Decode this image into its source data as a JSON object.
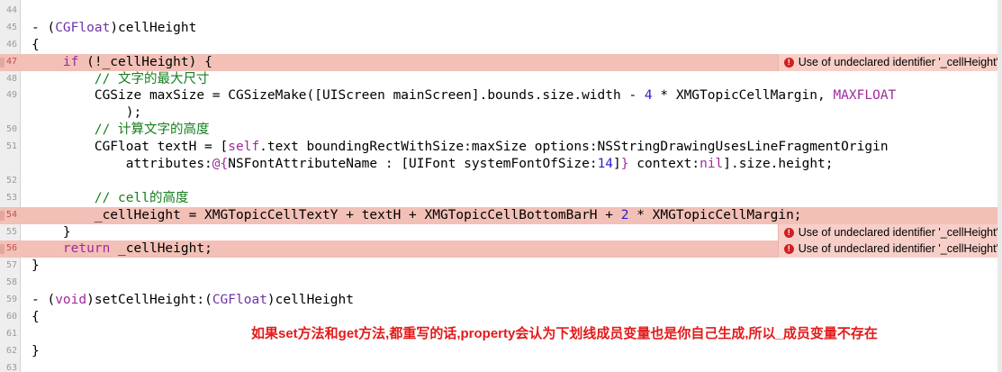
{
  "editor": {
    "lines": [
      {
        "num": "44",
        "tokens": [
          {
            "t": "",
            "c": ""
          }
        ]
      },
      {
        "num": "45",
        "tokens": [
          {
            "t": "- (",
            "c": ""
          },
          {
            "t": "CGFloat",
            "c": "ty"
          },
          {
            "t": ")cellHeight",
            "c": ""
          }
        ]
      },
      {
        "num": "46",
        "tokens": [
          {
            "t": "{",
            "c": ""
          }
        ]
      },
      {
        "num": "47",
        "error": true,
        "badge": "Use of undeclared identifier '_cellHeight'",
        "tokens": [
          {
            "t": "    ",
            "c": ""
          },
          {
            "t": "if",
            "c": "kw"
          },
          {
            "t": " (!_cellHeight) {",
            "c": ""
          }
        ]
      },
      {
        "num": "48",
        "tokens": [
          {
            "t": "        // 文字的最大尺寸",
            "c": "cm"
          }
        ]
      },
      {
        "num": "49",
        "tokens": [
          {
            "t": "        CGSize maxSize = CGSizeMake([UIScreen mainScreen].bounds.size.width - ",
            "c": ""
          },
          {
            "t": "4",
            "c": "num"
          },
          {
            "t": " * XMGTopicCellMargin, ",
            "c": ""
          },
          {
            "t": "MAXFLOAT",
            "c": "kw"
          }
        ]
      },
      {
        "num": "",
        "tokens": [
          {
            "t": "            );",
            "c": ""
          }
        ]
      },
      {
        "num": "50",
        "tokens": [
          {
            "t": "        // 计算文字的高度",
            "c": "cm"
          }
        ]
      },
      {
        "num": "51",
        "tokens": [
          {
            "t": "        CGFloat textH = [",
            "c": ""
          },
          {
            "t": "self",
            "c": "kw"
          },
          {
            "t": ".text boundingRectWithSize:maxSize options:NSStringDrawingUsesLineFragmentOrigin",
            "c": ""
          }
        ]
      },
      {
        "num": "",
        "tokens": [
          {
            "t": "            attributes:",
            "c": ""
          },
          {
            "t": "@{",
            "c": "kw"
          },
          {
            "t": "NSFontAttributeName : [UIFont systemFontOfSize:",
            "c": ""
          },
          {
            "t": "14",
            "c": "num"
          },
          {
            "t": "]",
            "c": ""
          },
          {
            "t": "}",
            "c": "kw"
          },
          {
            "t": " context:",
            "c": ""
          },
          {
            "t": "nil",
            "c": "kw"
          },
          {
            "t": "].size.height;",
            "c": ""
          }
        ]
      },
      {
        "num": "52",
        "tokens": [
          {
            "t": "",
            "c": ""
          }
        ]
      },
      {
        "num": "53",
        "tokens": [
          {
            "t": "        // cell的高度",
            "c": "cm"
          }
        ]
      },
      {
        "num": "54",
        "error": true,
        "tokens": [
          {
            "t": "        _cellHeight = XMGTopicCellTextY + textH + XMGTopicCellBottomBarH + ",
            "c": ""
          },
          {
            "t": "2",
            "c": "num"
          },
          {
            "t": " * XMGTopicCellMargin;",
            "c": ""
          }
        ]
      },
      {
        "num": "55",
        "badge": "Use of undeclared identifier '_cellHeight'",
        "tokens": [
          {
            "t": "    }",
            "c": ""
          }
        ]
      },
      {
        "num": "56",
        "error": true,
        "badge": "Use of undeclared identifier '_cellHeight'",
        "tokens": [
          {
            "t": "    ",
            "c": ""
          },
          {
            "t": "return",
            "c": "kw"
          },
          {
            "t": " _cellHeight;",
            "c": ""
          }
        ]
      },
      {
        "num": "57",
        "tokens": [
          {
            "t": "}",
            "c": ""
          }
        ]
      },
      {
        "num": "58",
        "tokens": [
          {
            "t": "",
            "c": ""
          }
        ]
      },
      {
        "num": "59",
        "tokens": [
          {
            "t": "- (",
            "c": ""
          },
          {
            "t": "void",
            "c": "kw"
          },
          {
            "t": ")setCellHeight:(",
            "c": ""
          },
          {
            "t": "CGFloat",
            "c": "ty"
          },
          {
            "t": ")cellHeight",
            "c": ""
          }
        ]
      },
      {
        "num": "60",
        "tokens": [
          {
            "t": "{",
            "c": ""
          }
        ]
      },
      {
        "num": "61",
        "tokens": [
          {
            "t": "",
            "c": ""
          }
        ]
      },
      {
        "num": "62",
        "tokens": [
          {
            "t": "}",
            "c": ""
          }
        ]
      },
      {
        "num": "63",
        "tokens": [
          {
            "t": "",
            "c": ""
          }
        ]
      }
    ]
  },
  "note": "如果set方法和get方法,都重写的话,property会认为下划线成员变量也是你自己生成,所以_成员变量不存在",
  "colors": {
    "error_line": "#f2c0b6",
    "keyword": "#a02a9e",
    "comment": "#157f1f",
    "number": "#2a1fd1",
    "note": "#e31a1a"
  },
  "icons": {
    "error": "exclamation-circle-icon"
  }
}
